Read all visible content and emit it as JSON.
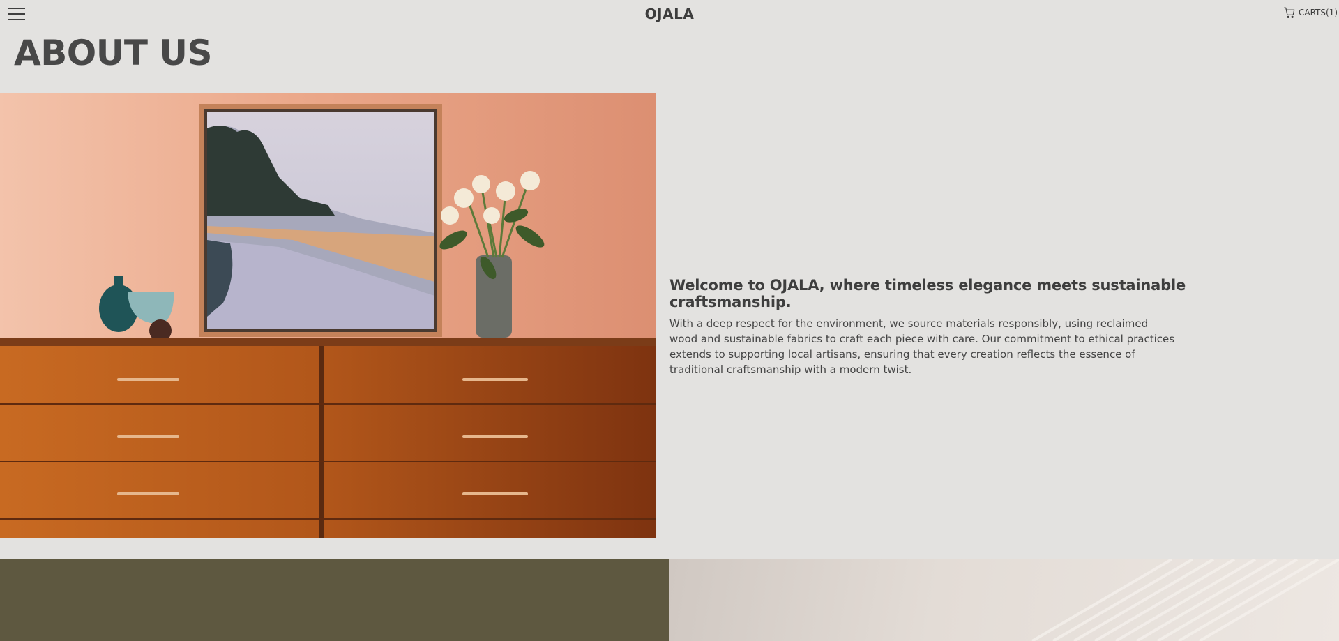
{
  "header": {
    "brand": "OJALA",
    "cart_label": "CARTS(1)",
    "menu_icon": "hamburger-menu-icon",
    "cart_icon": "shopping-cart-icon"
  },
  "page_title": "ABOUT US",
  "hero": {
    "image_alt": "Wooden sideboard with framed landscape painting, ceramic vases and a vase of flowers against a peach wall"
  },
  "about": {
    "headline": "Welcome to OJALA, where timeless elegance meets sustainable craftsmanship.",
    "body": "With a deep respect for the environment, we source materials responsibly, using reclaimed wood and sustainable fabrics to craft each piece with care. Our commitment to ethical practices extends to supporting local artisans, ensuring that every creation reflects the essence of traditional craftsmanship with a modern twist."
  },
  "colors": {
    "background": "#e3e2e0",
    "text": "#3a3a3a",
    "olive_panel": "#5e5840"
  }
}
